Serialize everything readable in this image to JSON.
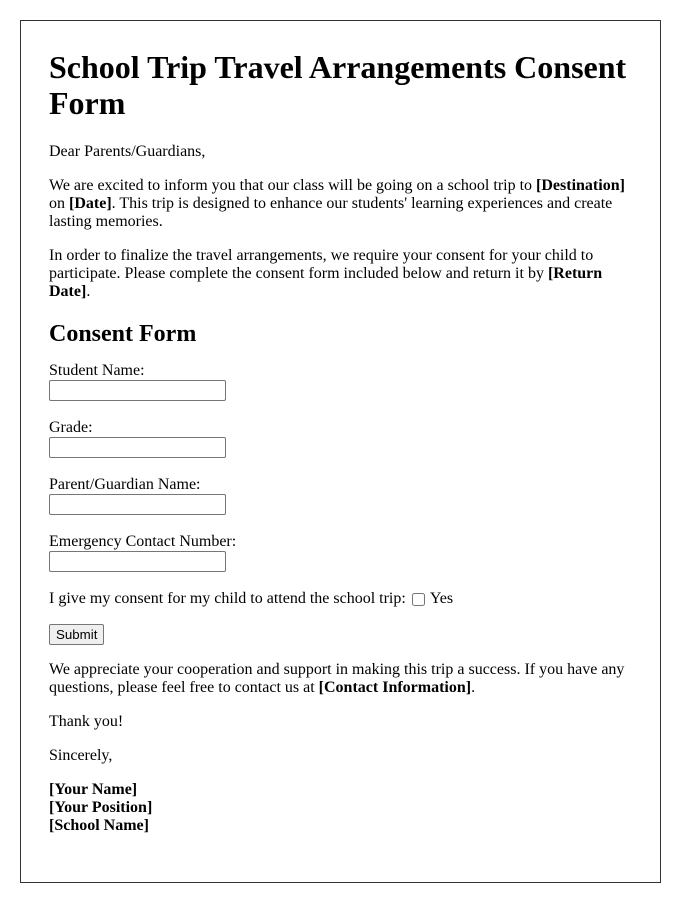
{
  "document": {
    "title": "School Trip Travel Arrangements Consent Form",
    "greeting": "Dear Parents/Guardians,",
    "intro": {
      "text1": "We are excited to inform you that our class will be going on a school trip to ",
      "destination": "[Destination]",
      "text2": " on ",
      "date": "[Date]",
      "text3": ". This trip is designed to enhance our students' learning experiences and create lasting memories."
    },
    "request": {
      "text1": "In order to finalize the travel arrangements, we require your consent for your child to participate. Please complete the consent form included below and return it by ",
      "return_date": "[Return Date]",
      "text2": "."
    }
  },
  "form": {
    "heading": "Consent Form",
    "fields": [
      {
        "label": "Student Name:",
        "value": ""
      },
      {
        "label": "Grade:",
        "value": ""
      },
      {
        "label": "Parent/Guardian Name:",
        "value": ""
      },
      {
        "label": "Emergency Contact Number:",
        "value": ""
      }
    ],
    "consent_text": "I give my consent for my child to attend the school trip:",
    "consent_option": "Yes",
    "consent_checked": false,
    "submit_label": "Submit"
  },
  "closing": {
    "text1": "We appreciate your cooperation and support in making this trip a success. If you have any questions, please feel free to contact us at ",
    "contact": "[Contact Information]",
    "text2": ".",
    "thanks": "Thank you!",
    "signoff": "Sincerely,",
    "signature": {
      "name": "[Your Name]",
      "position": "[Your Position]",
      "school": "[School Name]"
    }
  }
}
